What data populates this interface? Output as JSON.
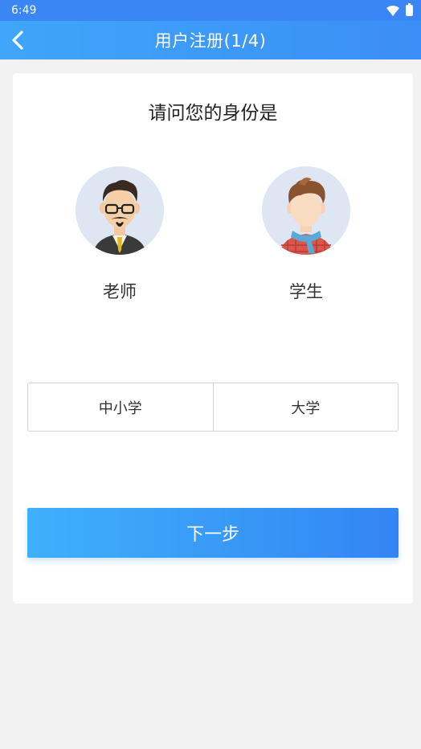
{
  "status_bar": {
    "time": "6:49"
  },
  "app_bar": {
    "title": "用户注册(1/4)"
  },
  "card": {
    "question": "请问您的身份是",
    "roles": [
      {
        "label": "老师",
        "icon": "teacher-avatar-icon"
      },
      {
        "label": "学生",
        "icon": "student-avatar-icon"
      }
    ],
    "levels": [
      "中小学",
      "大学"
    ],
    "next_label": "下一步"
  },
  "colors": {
    "primary": "#3b8ef5",
    "avatar_bg": "#dde6f2",
    "page_bg": "#f2f2f2"
  }
}
